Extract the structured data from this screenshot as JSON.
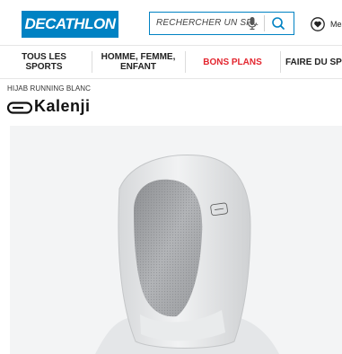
{
  "header": {
    "logo_text": "DECATHLON",
    "search_placeholder": "RECHERCHER UN SP...",
    "wishlist_label": "Mes"
  },
  "nav": {
    "items": [
      "TOUS LES SPORTS",
      "HOMME, FEMME, ENFANT",
      "BONS PLANS",
      "FAIRE DU SP"
    ]
  },
  "product": {
    "title": "HIJAB RUNNING BLANC",
    "brand": "Kalenji"
  },
  "colors": {
    "brand_blue": "#0082c3",
    "promo_red": "#e3262f",
    "image_bg": "#f3f4f5"
  }
}
